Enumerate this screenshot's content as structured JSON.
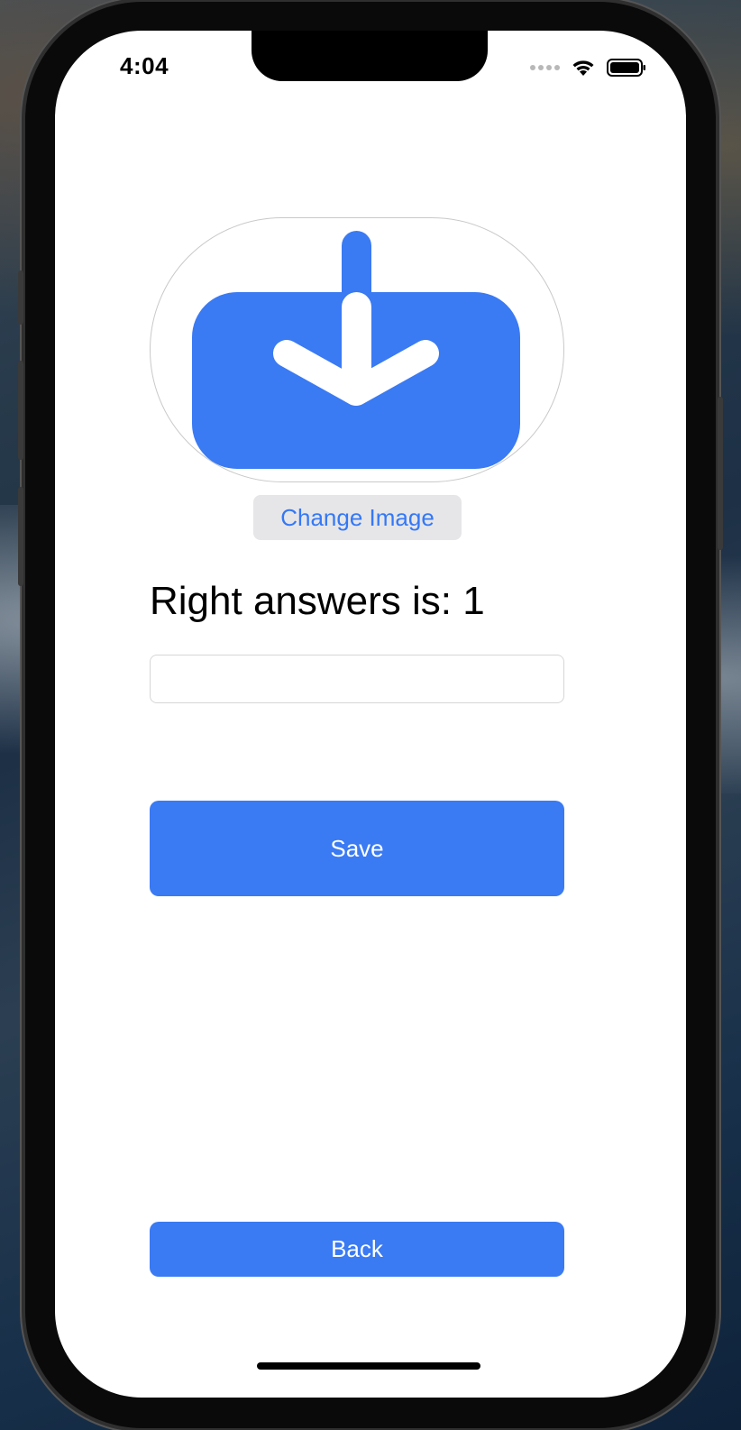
{
  "status_bar": {
    "time": "4:04",
    "icons": [
      "cellular-dots-icon",
      "wifi-icon",
      "battery-icon"
    ]
  },
  "image_view": {
    "icon": "download-tray-icon",
    "icon_color": "#3a7af3"
  },
  "change_image_button": {
    "label": "Change Image"
  },
  "right_answers": {
    "text": "Right answers is: 1"
  },
  "answer_input": {
    "value": "",
    "placeholder": ""
  },
  "save_button": {
    "label": "Save"
  },
  "back_button": {
    "label": "Back"
  },
  "colors": {
    "accent": "#3a7af3",
    "link": "#3478f6",
    "secondary_button_bg": "#e6e6e8"
  }
}
